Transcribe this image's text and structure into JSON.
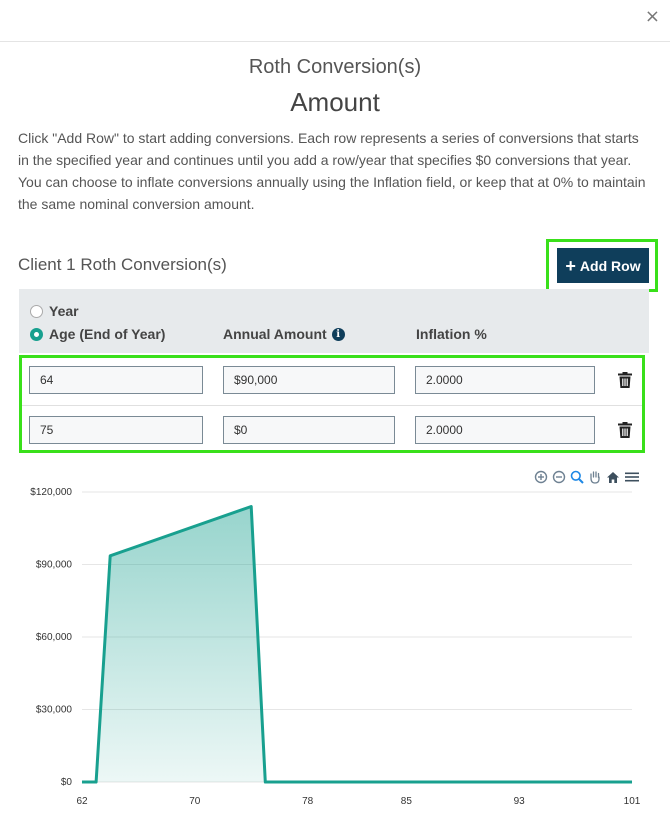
{
  "dialog": {
    "title": "Roth Conversion(s)",
    "subtitle": "Amount",
    "description": "Click \"Add Row\" to start adding conversions. Each row represents a series of conversions that starts in the specified year and continues until you add a row/year that specifies $0 conversions that year. You can choose to inflate conversions annually using the Inflation field, or keep that at 0% to maintain the same nominal conversion amount.",
    "close_label": "×"
  },
  "client": {
    "title": "Client 1 Roth Conversion(s)",
    "add_row_label": "Add Row"
  },
  "header": {
    "year_option": "Year",
    "age_option": "Age (End of Year)",
    "selected_option": "age",
    "annual_amount_label": "Annual Amount",
    "inflation_label": "Inflation %"
  },
  "rows": [
    {
      "age": "64",
      "amount": "$90,000",
      "inflation": "2.0000"
    },
    {
      "age": "75",
      "amount": "$0",
      "inflation": "2.0000"
    }
  ],
  "colors": {
    "accent": "#18a08f",
    "button": "#0f3e5b",
    "highlight": "#39e01a"
  },
  "toolbar_icons": [
    "zoom-in-icon",
    "zoom-out-icon",
    "selection-zoom-icon",
    "pan-hand-icon",
    "home-reset-icon",
    "menu-icon"
  ],
  "chart_data": {
    "type": "area",
    "x": [
      62,
      63,
      64,
      74,
      75,
      101
    ],
    "values": [
      0,
      0,
      93600,
      114000,
      0,
      0
    ],
    "x_ticks": [
      62,
      70,
      78,
      85,
      93,
      101
    ],
    "x_tick_labels": [
      "62",
      "70",
      "78",
      "85",
      "93",
      "101"
    ],
    "y_ticks": [
      0,
      30000,
      60000,
      90000,
      120000
    ],
    "y_tick_labels": [
      "$0",
      "$30,000",
      "$60,000",
      "$90,000",
      "$120,000"
    ],
    "xlim": [
      62,
      101
    ],
    "ylim": [
      0,
      120000
    ],
    "grid": true,
    "title": "",
    "xlabel": "",
    "ylabel": ""
  }
}
